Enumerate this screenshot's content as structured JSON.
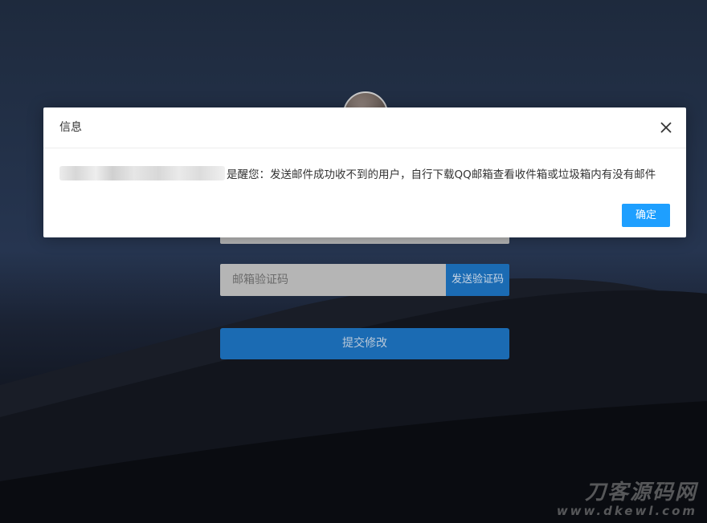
{
  "dialog": {
    "title": "信息",
    "message": "是醒您：发送邮件成功收不到的用户，自行下载QQ邮箱查看收件箱或垃圾箱内有没有邮件",
    "confirm_label": "确定"
  },
  "form": {
    "email_code_placeholder": "邮箱验证码",
    "send_code_label": "发送验证码",
    "submit_label": "提交修改"
  },
  "watermark": {
    "title": "刀客源码网",
    "url": "www.dkewl.com"
  },
  "colors": {
    "accent": "#1e9fff",
    "form_button": "#1b6bb3"
  }
}
